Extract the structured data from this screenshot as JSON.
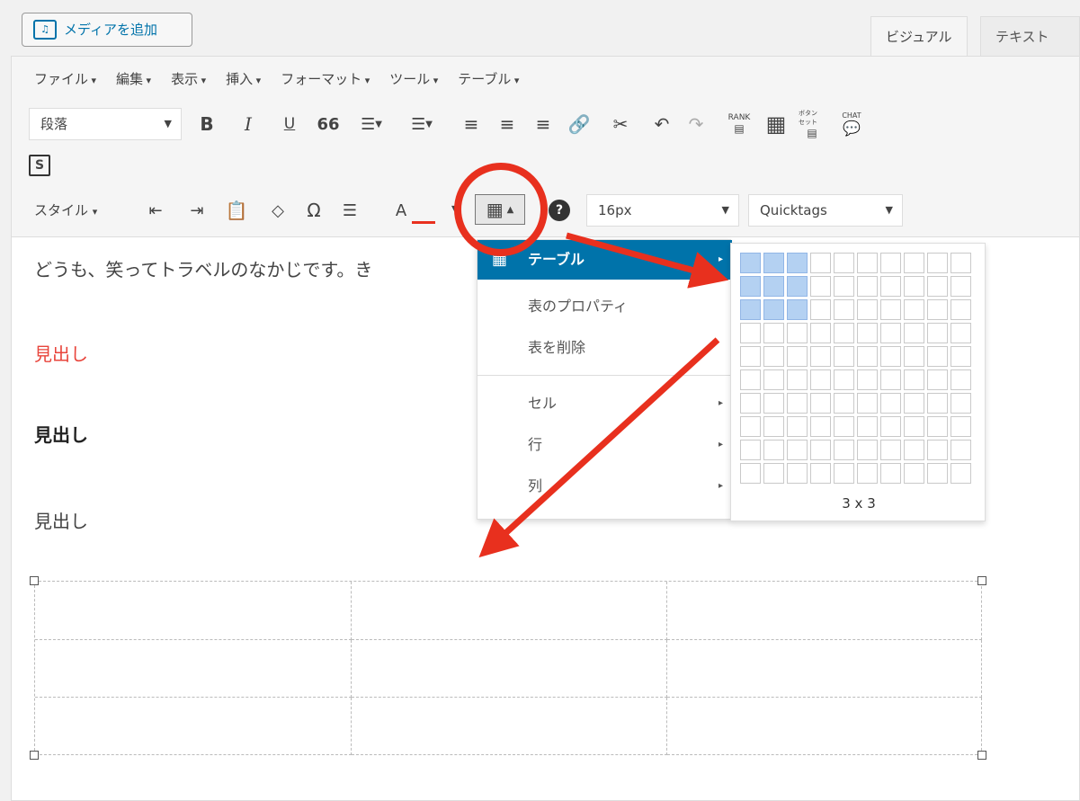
{
  "media_button": {
    "label": "メディアを追加",
    "icon": "media-add-icon"
  },
  "tabs": {
    "visual": "ビジュアル",
    "text": "テキスト"
  },
  "menu": [
    "ファイル",
    "編集",
    "表示",
    "挿入",
    "フォーマット",
    "ツール",
    "テーブル"
  ],
  "toolbar": {
    "format_select": "段落",
    "font_size": "16px",
    "quicktags": "Quicktags",
    "style_label": "スタイル",
    "bold": "B",
    "italic": "I",
    "underline": "U",
    "quote": "66",
    "omega": "Ω",
    "font_color": "A",
    "s_label": "S",
    "rank_label": "RANK",
    "chat_label": "CHAT",
    "button_label": "ボタン セット"
  },
  "content": {
    "intro": "どうも、笑ってトラベルのなかじです。き",
    "heading_red": "見出し",
    "heading_bold": "見出し",
    "heading_plain": "見出し"
  },
  "table_menu": {
    "items": [
      "テーブル",
      "表のプロパティ",
      "表を削除",
      "セル",
      "行",
      "列"
    ]
  },
  "grid_picker": {
    "label": "3 x 3",
    "rows": 10,
    "cols": 10,
    "selected_rows": 3,
    "selected_cols": 3
  },
  "colors": {
    "accent": "#0073aa",
    "annotation": "#e8301e",
    "heading_red": "#e8453c"
  }
}
